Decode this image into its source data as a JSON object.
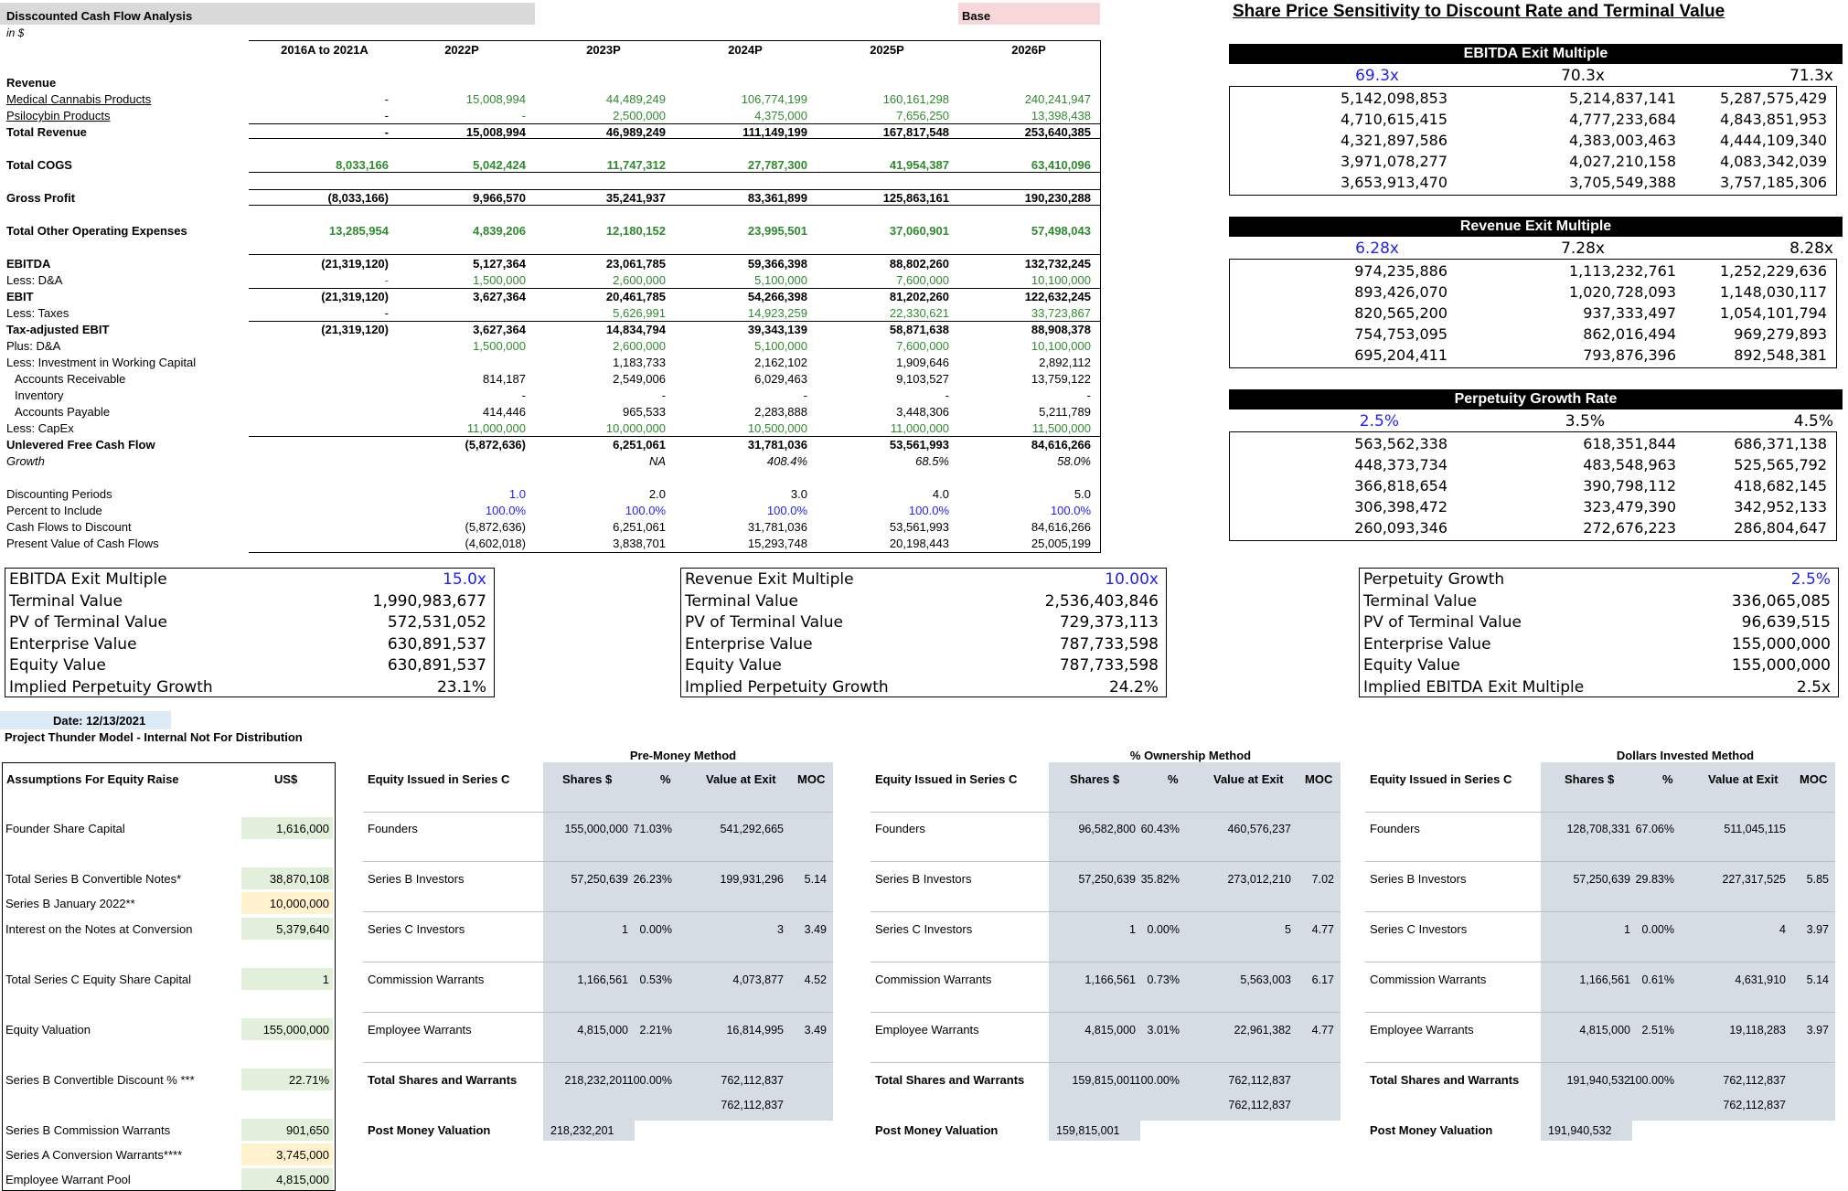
{
  "dcf": {
    "title": "Disscounted Cash Flow Analysis",
    "units": "in $",
    "scenario": "Base",
    "columns": [
      "2016A to 2021A",
      "2022P",
      "2023P",
      "2024P",
      "2025P",
      "2026P"
    ],
    "rows": [
      {
        "label": "Revenue",
        "values": [
          "",
          "",
          "",
          "",
          "",
          ""
        ]
      },
      {
        "label": "Medical Cannabis Products",
        "values": [
          "-",
          "15,008,994",
          "44,489,249",
          "106,774,199",
          "160,161,298",
          "240,241,947"
        ]
      },
      {
        "label": "Psilocybin Products",
        "values": [
          "-",
          "-",
          "2,500,000",
          "4,375,000",
          "7,656,250",
          "13,398,438"
        ]
      },
      {
        "label": "Total Revenue",
        "values": [
          "-",
          "15,008,994",
          "46,989,249",
          "111,149,199",
          "167,817,548",
          "253,640,385"
        ]
      },
      {
        "label": "Total COGS",
        "values": [
          "8,033,166",
          "5,042,424",
          "11,747,312",
          "27,787,300",
          "41,954,387",
          "63,410,096"
        ]
      },
      {
        "label": "Gross Profit",
        "values": [
          "(8,033,166)",
          "9,966,570",
          "35,241,937",
          "83,361,899",
          "125,863,161",
          "190,230,288"
        ]
      },
      {
        "label": "Total Other Operating Expenses",
        "values": [
          "13,285,954",
          "4,839,206",
          "12,180,152",
          "23,995,501",
          "37,060,901",
          "57,498,043"
        ]
      },
      {
        "label": "EBITDA",
        "values": [
          "(21,319,120)",
          "5,127,364",
          "23,061,785",
          "59,366,398",
          "88,802,260",
          "132,732,245"
        ]
      },
      {
        "label": "Less: D&A",
        "values": [
          "-",
          "1,500,000",
          "2,600,000",
          "5,100,000",
          "7,600,000",
          "10,100,000"
        ]
      },
      {
        "label": "EBIT",
        "values": [
          "(21,319,120)",
          "3,627,364",
          "20,461,785",
          "54,266,398",
          "81,202,260",
          "122,632,245"
        ]
      },
      {
        "label": "Less: Taxes",
        "values": [
          "-",
          "",
          "5,626,991",
          "14,923,259",
          "22,330,621",
          "33,723,867"
        ]
      },
      {
        "label": "Tax-adjusted EBIT",
        "values": [
          "(21,319,120)",
          "3,627,364",
          "14,834,794",
          "39,343,139",
          "58,871,638",
          "88,908,378"
        ]
      },
      {
        "label": "Plus: D&A",
        "values": [
          "",
          "1,500,000",
          "2,600,000",
          "5,100,000",
          "7,600,000",
          "10,100,000"
        ]
      },
      {
        "label": "Less: Investment in Working Capital",
        "values": [
          "",
          "",
          "1,183,733",
          "2,162,102",
          "1,909,646",
          "2,892,112"
        ]
      },
      {
        "label": "Accounts Receivable",
        "values": [
          "",
          "814,187",
          "2,549,006",
          "6,029,463",
          "9,103,527",
          "13,759,122"
        ]
      },
      {
        "label": "Inventory",
        "values": [
          "",
          "-",
          "-",
          "-",
          "-",
          "-"
        ]
      },
      {
        "label": "Accounts Payable",
        "values": [
          "",
          "414,446",
          "965,533",
          "2,283,888",
          "3,448,306",
          "5,211,789"
        ]
      },
      {
        "label": "Less: CapEx",
        "values": [
          "",
          "11,000,000",
          "10,000,000",
          "10,500,000",
          "11,000,000",
          "11,500,000"
        ]
      },
      {
        "label": "Unlevered Free Cash Flow",
        "values": [
          "",
          "(5,872,636)",
          "6,251,061",
          "31,781,036",
          "53,561,993",
          "84,616,266"
        ]
      },
      {
        "label": "Growth",
        "values": [
          "",
          "",
          "NA",
          "408.4%",
          "68.5%",
          "58.0%"
        ]
      },
      {
        "label": "Discounting Periods",
        "values": [
          "",
          "1.0",
          "2.0",
          "3.0",
          "4.0",
          "5.0"
        ]
      },
      {
        "label": "Percent to Include",
        "values": [
          "",
          "100.0%",
          "100.0%",
          "100.0%",
          "100.0%",
          "100.0%"
        ]
      },
      {
        "label": "Cash Flows to Discount",
        "values": [
          "",
          "(5,872,636)",
          "6,251,061",
          "31,781,036",
          "53,561,993",
          "84,616,266"
        ]
      },
      {
        "label": "Present Value of Cash Flows",
        "values": [
          "",
          "(4,602,018)",
          "3,838,701",
          "15,293,748",
          "20,198,443",
          "25,005,199"
        ]
      }
    ]
  },
  "sens": {
    "title": "Share Price Sensitivity to Discount Rate and Terminal Value",
    "tables": [
      {
        "header": "EBITDA Exit Multiple",
        "cols": [
          "69.3x",
          "70.3x",
          "71.3x"
        ],
        "rows": [
          [
            "5,142,098,853",
            "5,214,837,141",
            "5,287,575,429"
          ],
          [
            "4,710,615,415",
            "4,777,233,684",
            "4,843,851,953"
          ],
          [
            "4,321,897,586",
            "4,383,003,463",
            "4,444,109,340"
          ],
          [
            "3,971,078,277",
            "4,027,210,158",
            "4,083,342,039"
          ],
          [
            "3,653,913,470",
            "3,705,549,388",
            "3,757,185,306"
          ]
        ]
      },
      {
        "header": "Revenue Exit Multiple",
        "cols": [
          "6.28x",
          "7.28x",
          "8.28x"
        ],
        "rows": [
          [
            "974,235,886",
            "1,113,232,761",
            "1,252,229,636"
          ],
          [
            "893,426,070",
            "1,020,728,093",
            "1,148,030,117"
          ],
          [
            "820,565,200",
            "937,333,497",
            "1,054,101,794"
          ],
          [
            "754,753,095",
            "862,016,494",
            "969,279,893"
          ],
          [
            "695,204,411",
            "793,876,396",
            "892,548,381"
          ]
        ]
      },
      {
        "header": "Perpetuity Growth Rate",
        "cols": [
          "2.5%",
          "3.5%",
          "4.5%"
        ],
        "rows": [
          [
            "563,562,338",
            "618,351,844",
            "686,371,138"
          ],
          [
            "448,373,734",
            "483,548,963",
            "525,565,792"
          ],
          [
            "366,818,654",
            "390,798,112",
            "418,682,145"
          ],
          [
            "306,398,472",
            "323,479,390",
            "342,952,133"
          ],
          [
            "260,093,346",
            "272,676,223",
            "286,804,647"
          ]
        ]
      }
    ]
  },
  "summaries": [
    {
      "rows": [
        [
          "EBITDA Exit Multiple",
          "15.0x"
        ],
        [
          "Terminal Value",
          "1,990,983,677"
        ],
        [
          "PV of Terminal Value",
          "572,531,052"
        ],
        [
          "Enterprise Value",
          "630,891,537"
        ],
        [
          "Equity Value",
          "630,891,537"
        ],
        [
          "Implied Perpetuity Growth",
          "23.1%"
        ]
      ]
    },
    {
      "rows": [
        [
          "Revenue Exit Multiple",
          "10.00x"
        ],
        [
          "Terminal Value",
          "2,536,403,846"
        ],
        [
          "PV of Terminal Value",
          "729,373,113"
        ],
        [
          "Enterprise Value",
          "787,733,598"
        ],
        [
          "Equity Value",
          "787,733,598"
        ],
        [
          "Implied Perpetuity Growth",
          "24.2%"
        ]
      ]
    },
    {
      "rows": [
        [
          "Perpetuity Growth",
          "2.5%"
        ],
        [
          "Terminal Value",
          "336,065,085"
        ],
        [
          "PV of Terminal Value",
          "96,639,515"
        ],
        [
          "Enterprise Value",
          "155,000,000"
        ],
        [
          "Equity Value",
          "155,000,000"
        ],
        [
          "Implied EBITDA Exit Multiple",
          "2.5x"
        ]
      ]
    }
  ],
  "date": "Date:  12/13/2021",
  "project": "Project Thunder Model - Internal Not For Distribution",
  "assumptions": {
    "header": [
      "Assumptions For Equity Raise",
      "US$"
    ],
    "rows": [
      [
        "Founder Share Capital",
        "1,616,000"
      ],
      [
        "Total Series B Convertible Notes*",
        "38,870,108"
      ],
      [
        "Series B January 2022**",
        "10,000,000"
      ],
      [
        "Interest on the Notes at Conversion",
        "5,379,640"
      ],
      [
        "Total Series C Equity Share Capital",
        "1"
      ],
      [
        "Equity Valuation",
        "155,000,000"
      ],
      [
        "Series B Convertible Discount % ***",
        "22.71%"
      ],
      [
        "Series B Commission Warrants",
        "901,650"
      ],
      [
        "Series A Conversion Warrants****",
        "3,745,000"
      ],
      [
        "Employee Warrant Pool",
        "4,815,000"
      ]
    ]
  },
  "methods": [
    {
      "title": "Pre-Money Method",
      "header": [
        "Equity Issued in Series C",
        "Shares $",
        "%",
        "Value at Exit",
        "MOC"
      ],
      "rows": [
        [
          "Founders",
          "155,000,000",
          "71.03%",
          "541,292,665",
          ""
        ],
        [
          "Series B Investors",
          "57,250,639",
          "26.23%",
          "199,931,296",
          "5.14"
        ],
        [
          "Series C Investors",
          "1",
          "0.00%",
          "3",
          "3.49"
        ],
        [
          "Commission Warrants",
          "1,166,561",
          "0.53%",
          "4,073,877",
          "4.52"
        ],
        [
          "Employee Warrants",
          "4,815,000",
          "2.21%",
          "16,814,995",
          "3.49"
        ],
        [
          "Total Shares and Warrants",
          "218,232,201",
          "100.00%",
          "762,112,837",
          ""
        ]
      ],
      "extra": "762,112,837",
      "post_label": "Post Money Valuation",
      "post": "218,232,201"
    },
    {
      "title": "% Ownership Method",
      "header": [
        "Equity Issued in Series C",
        "Shares $",
        "%",
        "Value at Exit",
        "MOC"
      ],
      "rows": [
        [
          "Founders",
          "96,582,800",
          "60.43%",
          "460,576,237",
          ""
        ],
        [
          "Series B Investors",
          "57,250,639",
          "35.82%",
          "273,012,210",
          "7.02"
        ],
        [
          "Series C Investors",
          "1",
          "0.00%",
          "5",
          "4.77"
        ],
        [
          "Commission Warrants",
          "1,166,561",
          "0.73%",
          "5,563,003",
          "6.17"
        ],
        [
          "Employee Warrants",
          "4,815,000",
          "3.01%",
          "22,961,382",
          "4.77"
        ],
        [
          "Total Shares and Warrants",
          "159,815,001",
          "100.00%",
          "762,112,837",
          ""
        ]
      ],
      "extra": "762,112,837",
      "post_label": "Post Money Valuation",
      "post": "159,815,001"
    },
    {
      "title": "Dollars Invested Method",
      "header": [
        "Equity Issued in Series C",
        "Shares $",
        "%",
        "Value at Exit",
        "MOC"
      ],
      "rows": [
        [
          "Founders",
          "128,708,331",
          "67.06%",
          "511,045,115",
          ""
        ],
        [
          "Series B Investors",
          "57,250,639",
          "29.83%",
          "227,317,525",
          "5.85"
        ],
        [
          "Series C Investors",
          "1",
          "0.00%",
          "4",
          "3.97"
        ],
        [
          "Commission Warrants",
          "1,166,561",
          "0.61%",
          "4,631,910",
          "5.14"
        ],
        [
          "Employee Warrants",
          "4,815,000",
          "2.51%",
          "19,118,283",
          "3.97"
        ],
        [
          "Total Shares and Warrants",
          "191,940,532",
          "100.00%",
          "762,112,837",
          ""
        ]
      ],
      "extra": "762,112,837",
      "post_label": "Post Money Valuation",
      "post": "191,940,532"
    }
  ]
}
